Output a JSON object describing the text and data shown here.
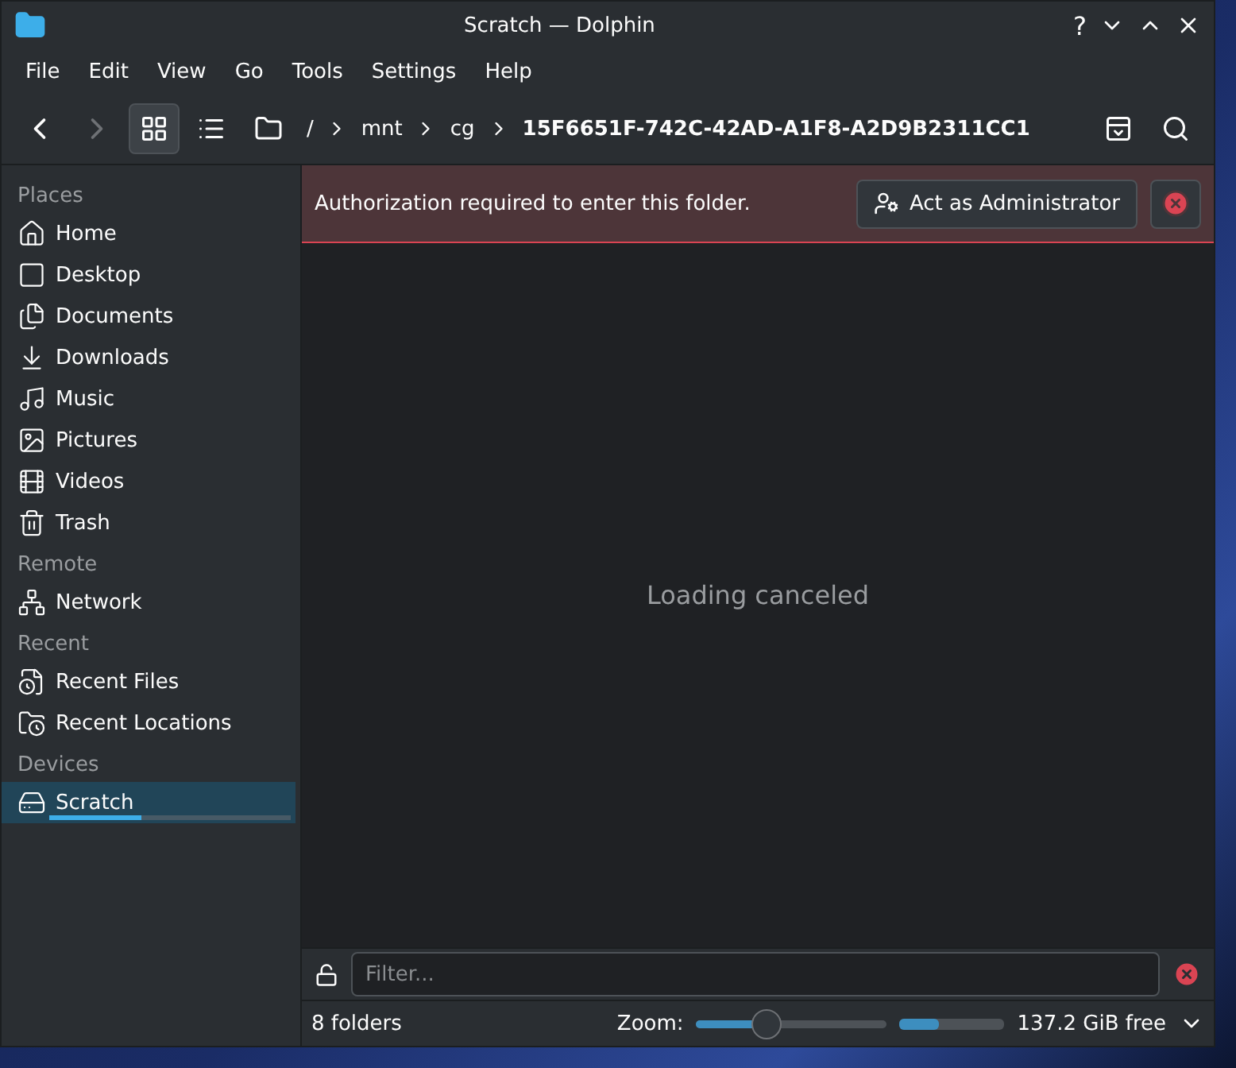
{
  "window": {
    "title": "Scratch — Dolphin",
    "help": "?"
  },
  "menu": [
    "File",
    "Edit",
    "View",
    "Go",
    "Tools",
    "Settings",
    "Help"
  ],
  "toolbar": {
    "views": [
      {
        "selected": true
      },
      {
        "selected": false
      },
      {
        "selected": false
      }
    ],
    "breadcrumb": [
      {
        "label": "/",
        "current": false
      },
      {
        "label": "mnt",
        "current": false
      },
      {
        "label": "cg",
        "current": false
      },
      {
        "label": "15F6651F-742C-42AD-A1F8-A2D9B2311CC1",
        "current": true
      }
    ]
  },
  "sidebar": [
    {
      "heading": "Places",
      "items": [
        {
          "label": "Home",
          "selected": false
        },
        {
          "label": "Desktop",
          "selected": false
        },
        {
          "label": "Documents",
          "selected": false
        },
        {
          "label": "Downloads",
          "selected": false
        },
        {
          "label": "Music",
          "selected": false
        },
        {
          "label": "Pictures",
          "selected": false
        },
        {
          "label": "Videos",
          "selected": false
        },
        {
          "label": "Trash",
          "selected": false
        }
      ]
    },
    {
      "heading": "Remote",
      "items": [
        {
          "label": "Network",
          "selected": false
        }
      ]
    },
    {
      "heading": "Recent",
      "items": [
        {
          "label": "Recent Files",
          "selected": false
        },
        {
          "label": "Recent Locations",
          "selected": false
        }
      ]
    },
    {
      "heading": "Devices",
      "items": [
        {
          "label": "Scratch",
          "selected": true,
          "level": 0.38
        }
      ]
    }
  ],
  "banner": {
    "message": "Authorization required to enter this folder.",
    "button": "Act as Administrator"
  },
  "content": {
    "message": "Loading canceled"
  },
  "filter": {
    "placeholder": "Filter..."
  },
  "status_bar": {
    "count": "8 folders",
    "zoom_label": "Zoom:",
    "zoom": {
      "level": 0.37
    },
    "space": {
      "level": 0.37
    },
    "free": "137.2 GiB free"
  }
}
